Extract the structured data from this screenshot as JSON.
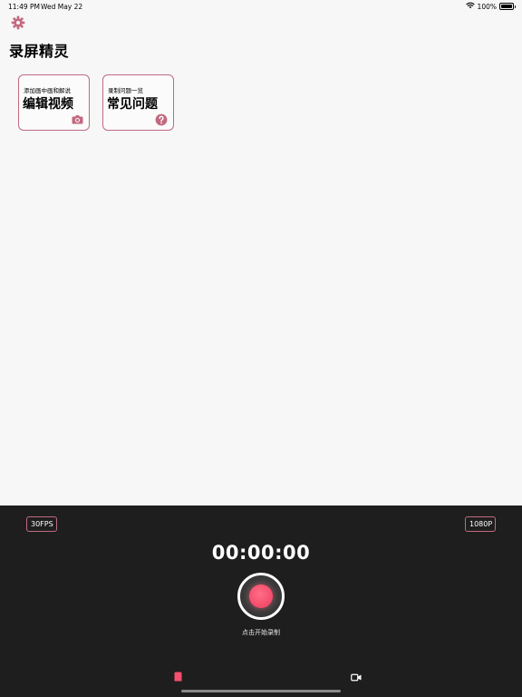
{
  "status_bar": {
    "time": "11:49 PM",
    "date": "Wed May 22",
    "battery_percent": "100%",
    "battery_level": 1.0,
    "icons": [
      "wifi-icon",
      "battery-icon"
    ]
  },
  "header": {
    "settings_icon": "gear-icon",
    "title": "录屏精灵"
  },
  "cards": [
    {
      "subtitle": "添加画中画和解说",
      "title": "编辑视频",
      "icon": "camera-icon"
    },
    {
      "subtitle": "录制问题一览",
      "title": "常见问题",
      "icon": "question-icon"
    }
  ],
  "recorder": {
    "fps_label": "30FPS",
    "resolution_label": "1080P",
    "timer": "00:00:00",
    "hint": "点击开始录制"
  },
  "tabs": [
    {
      "icon": "record-tab-icon",
      "active": true
    },
    {
      "icon": "video-camera-icon",
      "active": false
    }
  ],
  "colors": {
    "accent": "#f5506e",
    "card_border": "#c26a80",
    "panel_bg": "#1e1e1e",
    "page_bg": "#f7f7f7"
  }
}
